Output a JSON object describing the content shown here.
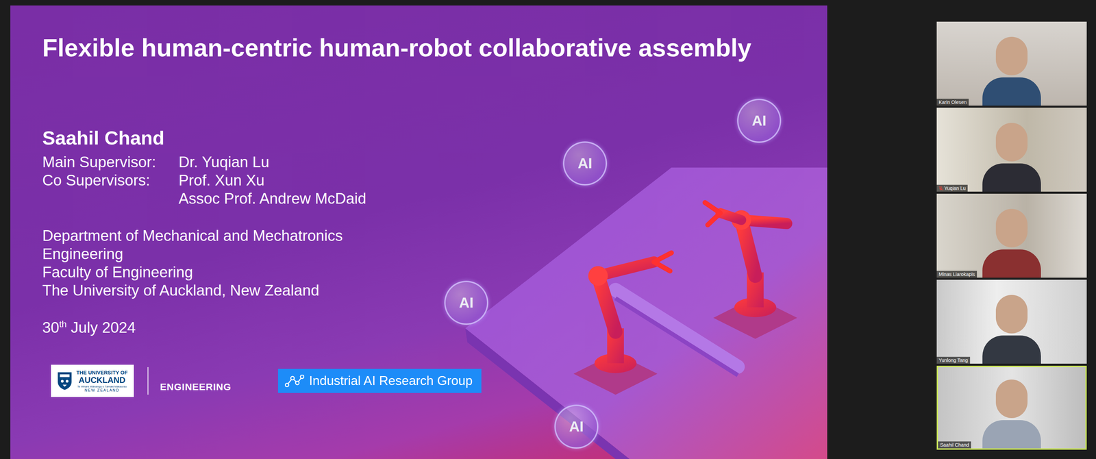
{
  "slide": {
    "title": "Flexible human-centric human-robot collaborative assembly",
    "author": "Saahil Chand",
    "supervisors": [
      {
        "role": "Main Supervisor:",
        "names": [
          "Dr. Yuqian Lu"
        ]
      },
      {
        "role": "Co Supervisors:",
        "names": [
          "Prof. Xun Xu",
          "Assoc Prof. Andrew McDaid"
        ]
      }
    ],
    "affiliation": [
      "Department of Mechanical and Mechatronics",
      "Engineering",
      "Faculty of Engineering",
      "The University of Auckland, New Zealand"
    ],
    "date": {
      "day": "30",
      "suffix": "th",
      "rest": "July 2024"
    },
    "badges": [
      "AI",
      "AI",
      "AI",
      "AI"
    ],
    "logos": {
      "university": [
        "THE UNIVERSITY OF",
        "AUCKLAND",
        "Te Whare Wānanga o Tāmaki Makaurau",
        "NEW ZEALAND"
      ],
      "faculty": "ENGINEERING",
      "group": "Industrial AI Research Group"
    }
  },
  "participants": [
    {
      "name": "Karin Olesen",
      "muted": false,
      "speaking": false
    },
    {
      "name": "Yuqian Lu",
      "muted": true,
      "speaking": false
    },
    {
      "name": "Minas Liarokapis",
      "muted": false,
      "speaking": false
    },
    {
      "name": "Yunlong Tang",
      "muted": false,
      "speaking": false
    },
    {
      "name": "Saahil Chand",
      "muted": false,
      "speaking": true
    }
  ]
}
